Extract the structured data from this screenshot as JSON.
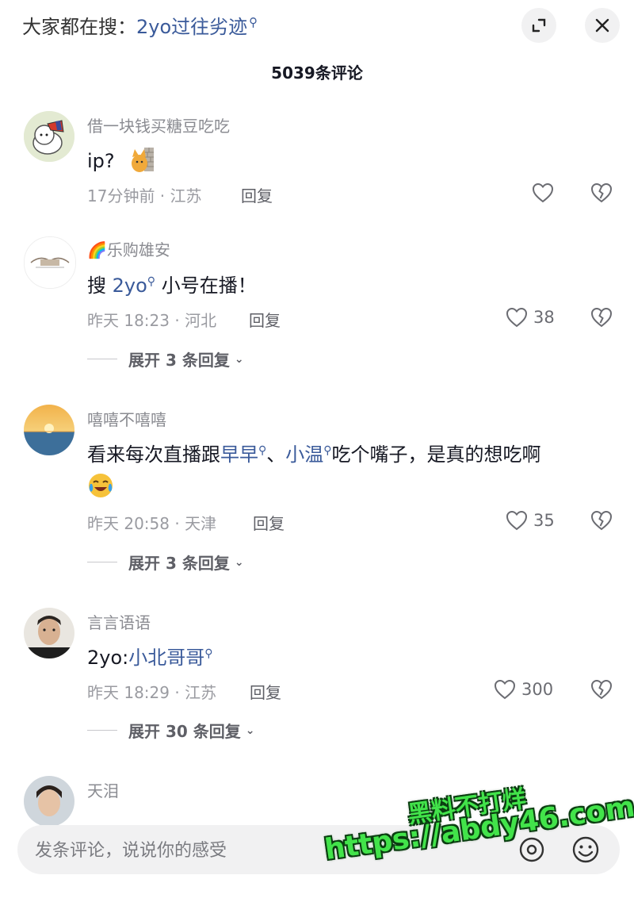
{
  "header": {
    "search_prefix": "大家都在搜：",
    "search_keyword": "2yo过往劣迹",
    "comment_count": "5039条评论"
  },
  "comments": [
    {
      "username": "借一块钱买糖豆吃吃",
      "text": "ip?",
      "time": "17分钟前 · 江苏",
      "reply": "回复",
      "likes": ""
    },
    {
      "username": "🌈乐购雄安",
      "text_before": "搜 ",
      "link": "2yo",
      "text_after": " 小号在播！",
      "time": "昨天 18:23 · 河北",
      "reply": "回复",
      "likes": "38",
      "expand": "展开 3 条回复"
    },
    {
      "username": "嘻嘻不嘻嘻",
      "text_before": "看来每次直播跟",
      "link1": "早早",
      "sep": "、",
      "link2": "小温",
      "text_after": "吃个嘴子，是真的想吃啊",
      "time": "昨天 20:58 · 天津",
      "reply": "回复",
      "likes": "35",
      "expand": "展开 3 条回复"
    },
    {
      "username": "言言语语",
      "text_before": "2yo:",
      "link": "小北哥哥",
      "time": "昨天 18:29 · 江苏",
      "reply": "回复",
      "likes": "300",
      "expand": "展开 30 条回复"
    },
    {
      "username": "天泪"
    }
  ],
  "footer": {
    "placeholder": "发条评论，说说你的感受"
  },
  "watermark": {
    "line1": "黑料不打烊",
    "line2": "https://abdy46.com"
  },
  "colors": {
    "link": "#3a5a9a",
    "watermark": "#42e34a"
  },
  "icons": [
    "magnifier-icon",
    "expand-icon",
    "close-icon",
    "heart-icon",
    "broken-heart-icon",
    "at-icon",
    "emoji-icon"
  ]
}
